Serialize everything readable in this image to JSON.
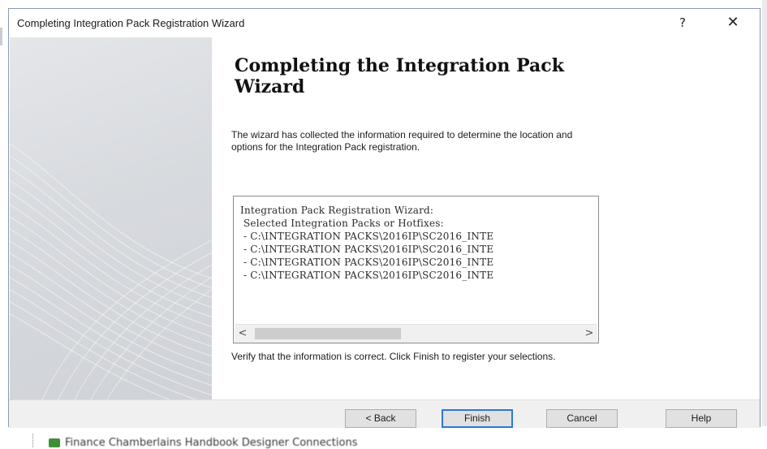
{
  "window": {
    "title": "Completing Integration Pack Registration Wizard",
    "help_glyph": "?",
    "close_glyph": "✕"
  },
  "content": {
    "heading": "Completing the Integration Pack Wizard",
    "intro": "The wizard has collected the information required to determine the location and options for the Integration Pack registration.",
    "summary_lines": [
      "Integration Pack Registration Wizard:",
      " Selected Integration Packs or Hotfixes:",
      " - C:\\INTEGRATION PACKS\\2016IP\\SC2016_INTE",
      " - C:\\INTEGRATION PACKS\\2016IP\\SC2016_INTE",
      " - C:\\INTEGRATION PACKS\\2016IP\\SC2016_INTE",
      " - C:\\INTEGRATION PACKS\\2016IP\\SC2016_INTE"
    ],
    "scroll_left_glyph": "<",
    "scroll_right_glyph": ">",
    "verify": "Verify that the information is correct.  Click Finish to register your selections."
  },
  "footer": {
    "back_label": "< Back",
    "finish_label": "Finish",
    "cancel_label": "Cancel",
    "help_label": "Help"
  },
  "background": {
    "behind_text": "Finance Chamberlains Handbook Designer Connections"
  },
  "colors": {
    "accent": "#2b78d6",
    "footer_bg": "#f0f0f0",
    "side_panel": "#d7dade"
  }
}
